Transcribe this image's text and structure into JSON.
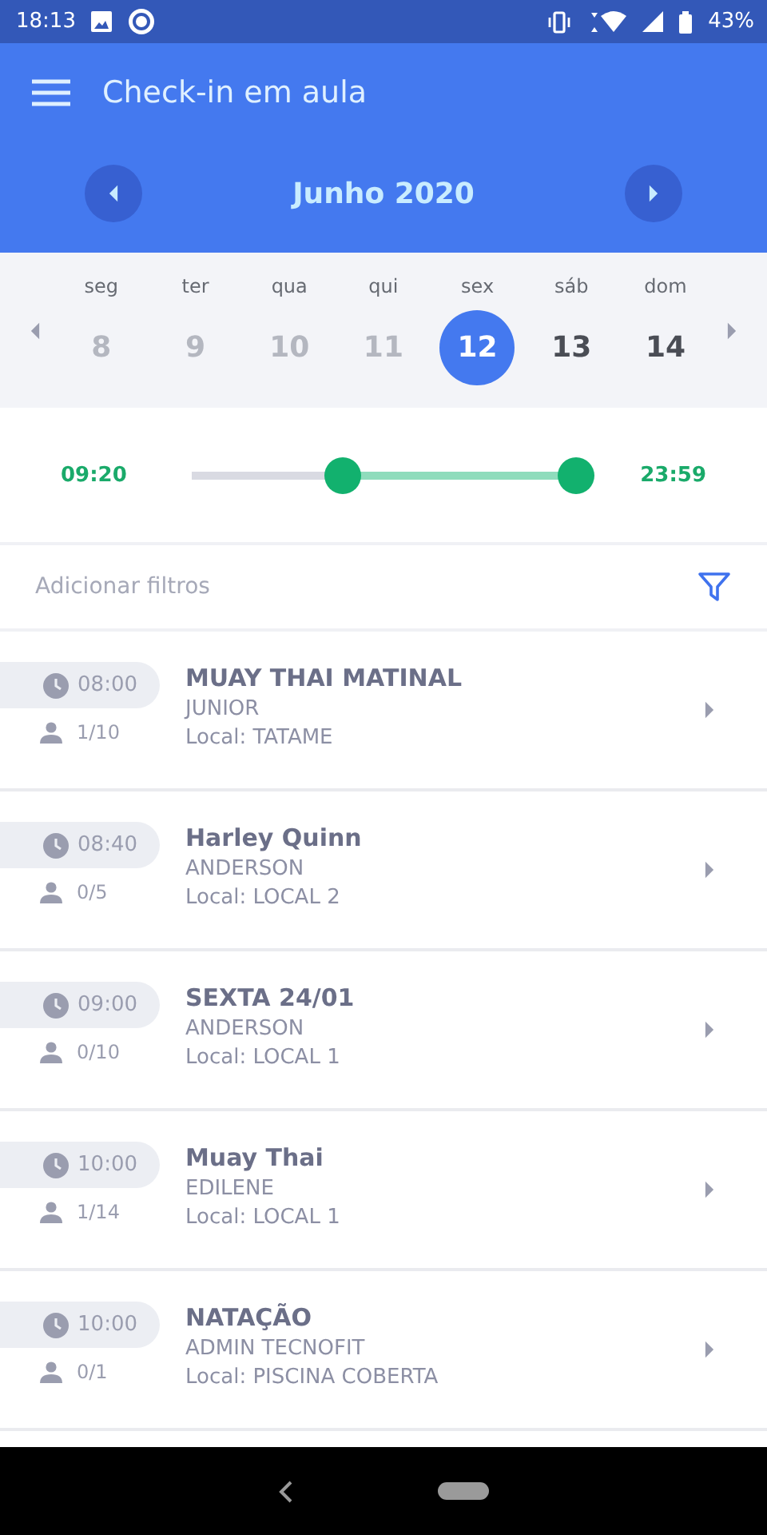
{
  "status_bar": {
    "time": "18:13",
    "battery": "43%"
  },
  "app_bar": {
    "title": "Check-in em aula"
  },
  "month": {
    "label": "Junho 2020"
  },
  "week": [
    {
      "weekday": "seg",
      "day": "8",
      "selected": false,
      "disabled": true
    },
    {
      "weekday": "ter",
      "day": "9",
      "selected": false,
      "disabled": true
    },
    {
      "weekday": "qua",
      "day": "10",
      "selected": false,
      "disabled": true
    },
    {
      "weekday": "qui",
      "day": "11",
      "selected": false,
      "disabled": true
    },
    {
      "weekday": "sex",
      "day": "12",
      "selected": true,
      "disabled": false
    },
    {
      "weekday": "sáb",
      "day": "13",
      "selected": false,
      "disabled": false
    },
    {
      "weekday": "dom",
      "day": "14",
      "selected": false,
      "disabled": false
    }
  ],
  "time_range": {
    "start": "09:20",
    "end": "23:59",
    "thumbs": [
      {
        "level": 0.39
      },
      {
        "level": 1
      }
    ]
  },
  "filters": {
    "placeholder": "Adicionar filtros"
  },
  "classes": [
    {
      "time": "08:00",
      "occupancy": "1/10",
      "name": "MUAY THAI MATINAL",
      "instructor": "JUNIOR",
      "location": "Local: TATAME"
    },
    {
      "time": "08:40",
      "occupancy": "0/5",
      "name": "Harley Quinn",
      "instructor": "ANDERSON",
      "location": "Local: LOCAL 2"
    },
    {
      "time": "09:00",
      "occupancy": "0/10",
      "name": "SEXTA 24/01",
      "instructor": "ANDERSON",
      "location": "Local: LOCAL 1"
    },
    {
      "time": "10:00",
      "occupancy": "1/14",
      "name": "Muay Thai",
      "instructor": "EDILENE",
      "location": "Local: LOCAL 1"
    },
    {
      "time": "10:00",
      "occupancy": "0/1",
      "name": "NATAÇÃO",
      "instructor": "ADMIN TECNOFIT",
      "location": "Local: PISCINA COBERTA"
    }
  ]
}
